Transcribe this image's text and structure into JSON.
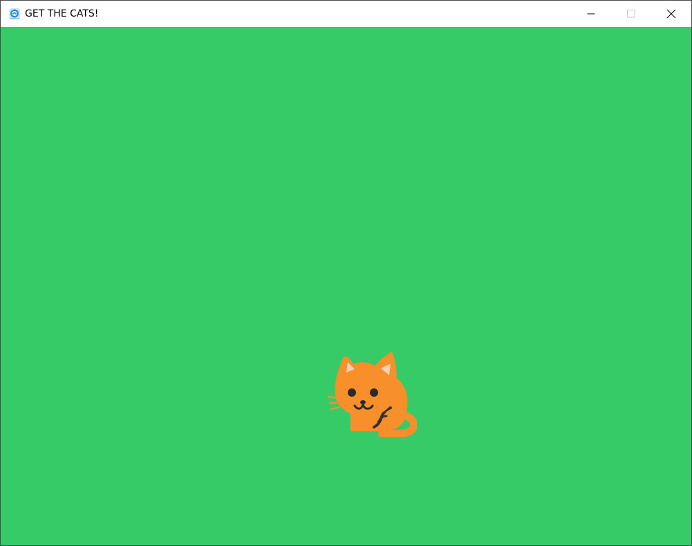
{
  "window": {
    "title": "GET THE CATS!",
    "app_icon": "app-icon",
    "controls": [
      "minimize-icon",
      "maximize-icon",
      "close-icon"
    ]
  },
  "game": {
    "background_color": "#37cb68",
    "sprite": {
      "name": "cat",
      "color": "#f7902a"
    }
  }
}
